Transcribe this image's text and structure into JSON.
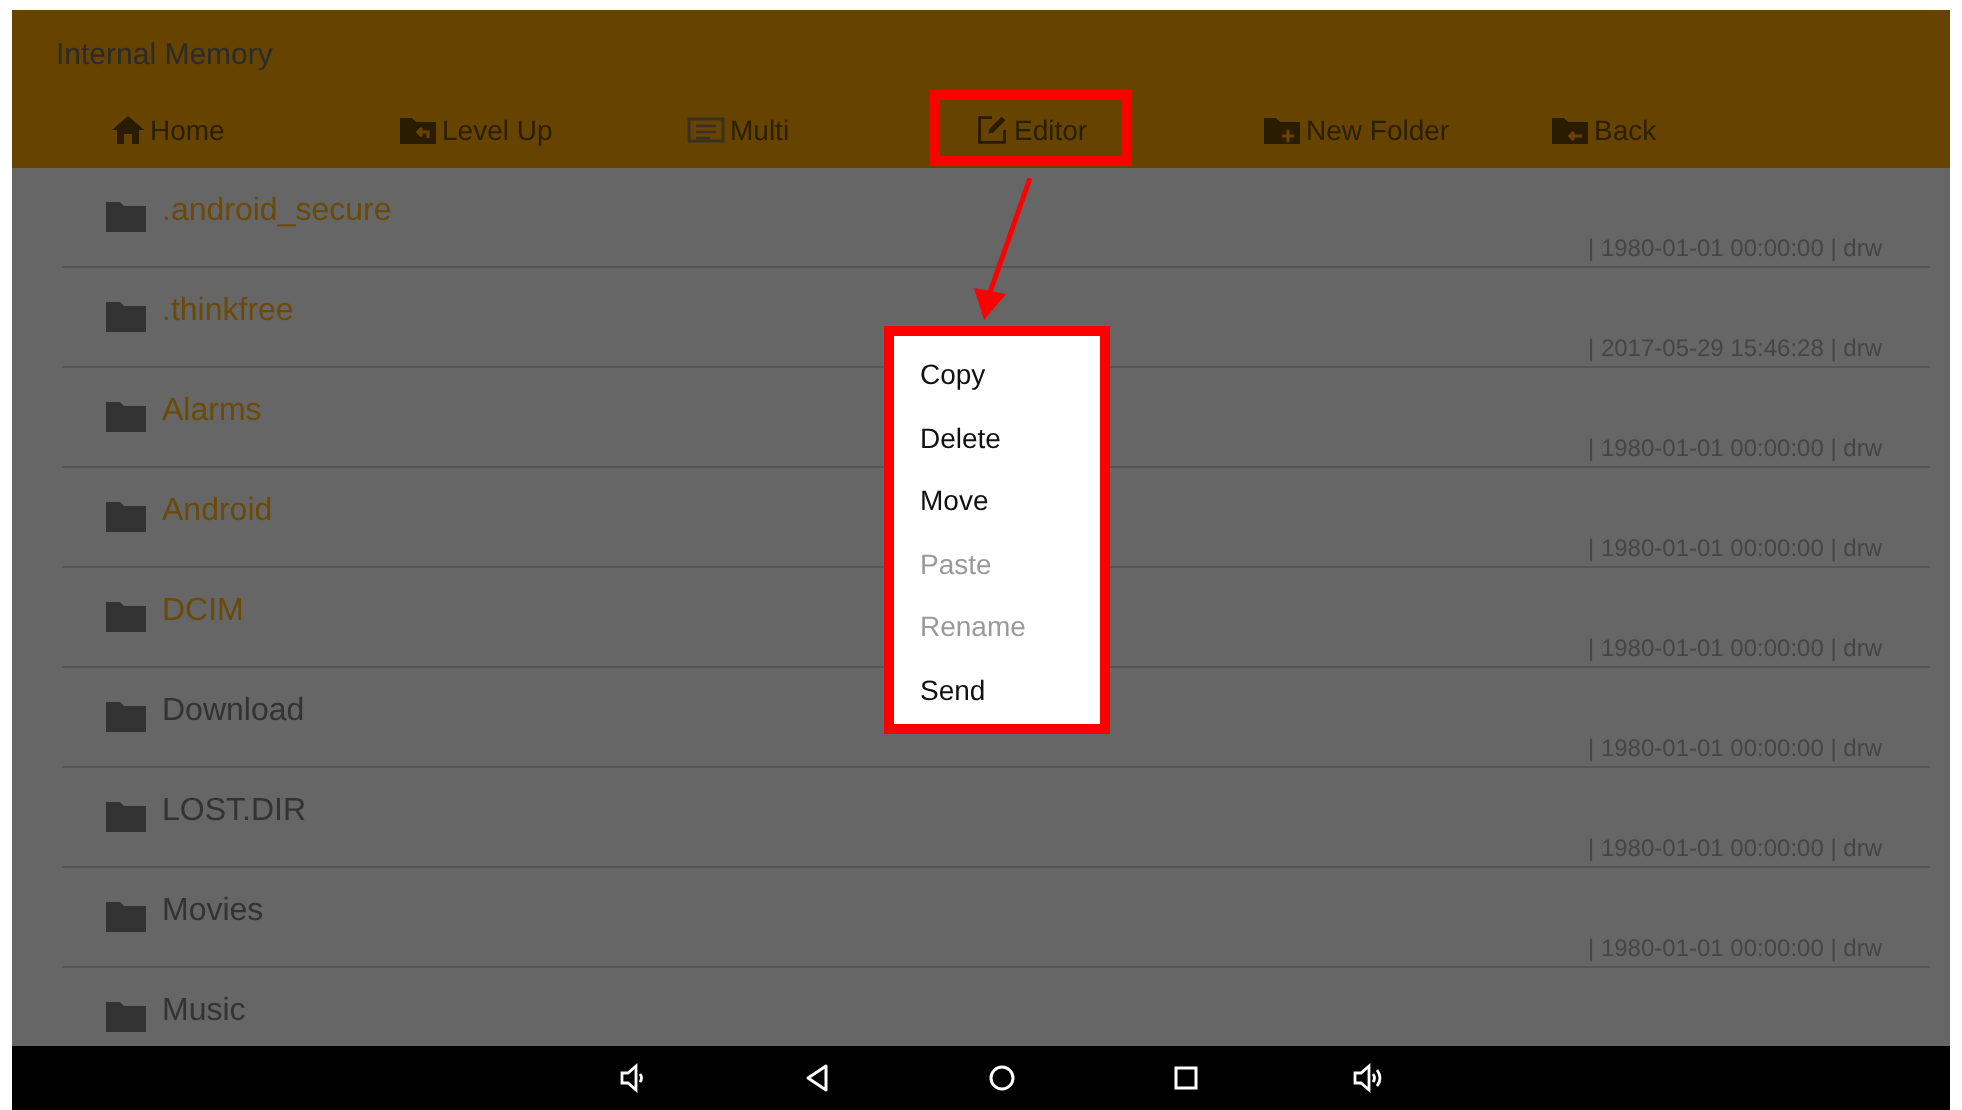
{
  "header": {
    "title": "Internal Memory"
  },
  "toolbar": [
    {
      "kind": "home",
      "label": "Home",
      "highlighted": false
    },
    {
      "kind": "level_up",
      "label": "Level Up",
      "highlighted": false
    },
    {
      "kind": "multi",
      "label": "Multi",
      "highlighted": false
    },
    {
      "kind": "editor",
      "label": "Editor",
      "highlighted": true
    },
    {
      "kind": "new_folder",
      "label": "New Folder",
      "highlighted": false
    },
    {
      "kind": "back",
      "label": "Back",
      "highlighted": false
    }
  ],
  "folders": [
    {
      "name": ".android_secure",
      "selected": true,
      "details": "| 1980-01-01 00:00:00 | drw"
    },
    {
      "name": ".thinkfree",
      "selected": true,
      "details": "| 2017-05-29 15:46:28 | drw"
    },
    {
      "name": "Alarms",
      "selected": true,
      "details": "| 1980-01-01 00:00:00 | drw"
    },
    {
      "name": "Android",
      "selected": true,
      "details": "| 1980-01-01 00:00:00 | drw"
    },
    {
      "name": "DCIM",
      "selected": true,
      "details": "| 1980-01-01 00:00:00 | drw"
    },
    {
      "name": "Download",
      "selected": false,
      "details": "| 1980-01-01 00:00:00 | drw"
    },
    {
      "name": "LOST.DIR",
      "selected": false,
      "details": "| 1980-01-01 00:00:00 | drw"
    },
    {
      "name": "Movies",
      "selected": false,
      "details": "| 1980-01-01 00:00:00 | drw"
    },
    {
      "name": "Music",
      "selected": false
    }
  ],
  "menu": {
    "items": [
      {
        "label": "Copy",
        "disabled": false
      },
      {
        "label": "Delete",
        "disabled": false
      },
      {
        "label": "Move",
        "disabled": false
      },
      {
        "label": "Paste",
        "disabled": true
      },
      {
        "label": "Rename",
        "disabled": true
      },
      {
        "label": "Send",
        "disabled": false
      }
    ]
  }
}
